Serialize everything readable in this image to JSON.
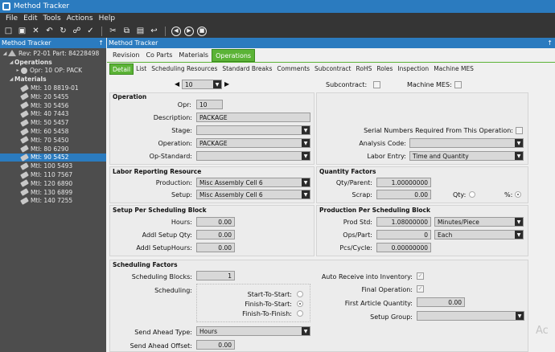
{
  "window": {
    "title": "Method Tracker"
  },
  "menu": [
    "File",
    "Edit",
    "Tools",
    "Actions",
    "Help"
  ],
  "toolbar": {
    "icons": [
      "new-icon",
      "save-icon",
      "delete-icon",
      "undo-icon",
      "refresh-icon",
      "attach-icon",
      "clear-icon",
      "cut-icon",
      "copy-icon",
      "paste-icon",
      "undo-arrow-icon",
      "back-icon",
      "forward-icon",
      "stop-icon"
    ]
  },
  "tree": {
    "panel_title": "Method Tracker",
    "pin": "↑",
    "root": "Rev: P2-01 Part: 84228498",
    "operations_label": "Operations",
    "operation_item": "Opr: 10 OP: PACK",
    "materials_label": "Materials",
    "materials": [
      "Mtl: 10 8819-01",
      "Mtl: 20 5455",
      "Mtl: 30 5456",
      "Mtl: 40 7443",
      "Mtl: 50 5457",
      "Mtl: 60 5458",
      "Mtl: 70 5450",
      "Mtl: 80 6290",
      "Mtl: 90 5452",
      "Mtl: 100 5493",
      "Mtl: 110 7567",
      "Mtl: 120 6890",
      "Mtl: 130 6899",
      "Mtl: 140 7255"
    ],
    "selected_index": 8
  },
  "main": {
    "panel_title": "Method Tracker",
    "pin": "↑",
    "tabs": [
      "Revision",
      "Co Parts",
      "Materials",
      "Operations"
    ],
    "active_tab": "Operations",
    "subtabs": [
      "Detail",
      "List",
      "Scheduling Resources",
      "Standard Breaks",
      "Comments",
      "Subcontract",
      "RoHS",
      "Roles",
      "Inspection",
      "Machine MES"
    ],
    "active_subtab": "Detail",
    "nav_value": "10",
    "subcontract_label": "Subcontract:",
    "machine_mes_label": "Machine MES:"
  },
  "operation": {
    "section": "Operation",
    "opr_label": "Opr:",
    "opr_value": "10",
    "description_label": "Description:",
    "description_value": "PACKAGE",
    "stage_label": "Stage:",
    "stage_value": "",
    "operation_label": "Operation:",
    "operation_value": "PACKAGE",
    "op_standard_label": "Op-Standard:",
    "op_standard_value": "",
    "serial_label": "Serial Numbers Required From This Operation:",
    "analysis_label": "Analysis Code:",
    "analysis_value": "",
    "labor_entry_label": "Labor Entry:",
    "labor_entry_value": "Time and Quantity"
  },
  "labor": {
    "section": "Labor Reporting Resource",
    "production_label": "Production:",
    "production_value": "Misc Assembly Cell 6",
    "setup_label": "Setup:",
    "setup_value": "Misc Assembly Cell 6"
  },
  "quantity": {
    "section": "Quantity Factors",
    "qty_parent_label": "Qty/Parent:",
    "qty_parent_value": "1.00000000",
    "scrap_label": "Scrap:",
    "scrap_value": "0.00",
    "qty_label": "Qty:",
    "pct_label": "%:"
  },
  "setup": {
    "section": "Setup Per Scheduling Block",
    "hours_label": "Hours:",
    "hours_value": "0.00",
    "addl_qty_label": "Addl Setup Qty:",
    "addl_qty_value": "0.00",
    "addl_hours_label": "Addl SetupHours:",
    "addl_hours_value": "0.00"
  },
  "production": {
    "section": "Production Per Scheduling Block",
    "prod_std_label": "Prod Std:",
    "prod_std_value": "1.08000000",
    "prod_std_unit": "Minutes/Piece",
    "ops_part_label": "Ops/Part:",
    "ops_part_value": "0",
    "ops_part_unit": "Each",
    "pcs_cycle_label": "Pcs/Cycle:",
    "pcs_cycle_value": "0.00000000"
  },
  "scheduling": {
    "section": "Scheduling Factors",
    "blocks_label": "Scheduling Blocks:",
    "blocks_value": "1",
    "scheduling_label": "Scheduling:",
    "opt_start_start": "Start-To-Start:",
    "opt_finish_start": "Finish-To-Start:",
    "opt_finish_finish": "Finish-To-Finish:",
    "selected_option": "finish-to-start",
    "auto_receive_label": "Auto Receive into Inventory:",
    "final_op_label": "Final Operation:",
    "first_article_label": "First Article Quantity:",
    "first_article_value": "0.00",
    "setup_group_label": "Setup Group:",
    "setup_group_value": "",
    "send_ahead_type_label": "Send Ahead Type:",
    "send_ahead_type_value": "Hours",
    "send_ahead_offset_label": "Send Ahead Offset:",
    "send_ahead_offset_value": "0.00"
  },
  "watermark": "Ac"
}
